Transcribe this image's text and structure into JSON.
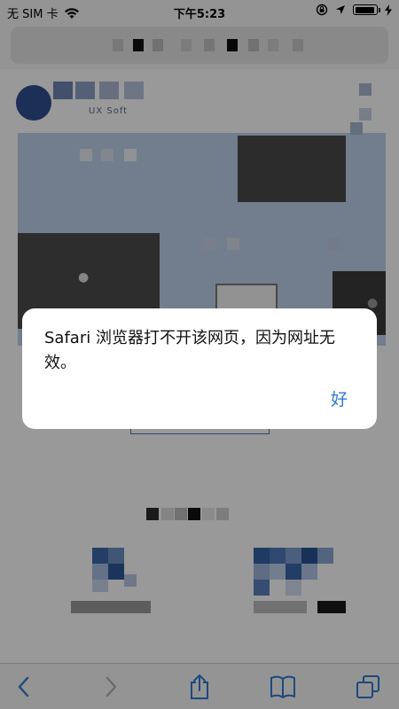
{
  "status_bar": {
    "carrier": "无 SIM 卡",
    "time": "下午5:23",
    "battery_level": 0.95
  },
  "page": {
    "logo_text": "UX Soft"
  },
  "alert": {
    "message": "Safari 浏览器打不开该网页，因为网址无效。",
    "ok_label": "好"
  },
  "colors": {
    "accent": "#2f7ad0",
    "overlay": "rgba(0,0,0,0.40)"
  },
  "toolbar": {
    "icons": [
      "back-icon",
      "forward-icon",
      "share-icon",
      "bookmarks-icon",
      "tabs-icon"
    ]
  }
}
